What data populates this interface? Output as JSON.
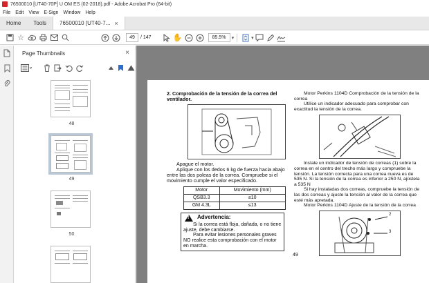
{
  "window": {
    "title": "76500010 [UT40-70P] U OM ES (02-2018).pdf - Adobe Acrobat Pro (64-bit)"
  },
  "menu": [
    "File",
    "Edit",
    "View",
    "E-Sign",
    "Window",
    "Help"
  ],
  "tabs": {
    "home": "Home",
    "tools": "Tools",
    "document": "76500010 [UT40-7...",
    "close": "×"
  },
  "toolbar": {
    "page_current": "49",
    "page_total": "/ 147",
    "zoom": "85.5%"
  },
  "panel": {
    "title": "Page Thumbnails",
    "close": "×",
    "thumbnails": [
      {
        "label": "48"
      },
      {
        "label": "49",
        "selected": true
      },
      {
        "label": "50"
      },
      {
        "label": ""
      }
    ]
  },
  "doc": {
    "left": {
      "heading": "2. Comprobación de la tensión de la correa del ventilador.",
      "p1": "Apague el motor.",
      "p2": "Aplique con los dedos 6 kg de fuerza hacia abajo entre las dos poleas de la correa. Compruebe si el movimiento cumple el valor especificado.",
      "table_headers": [
        "Motor",
        "Movimiento (mm)"
      ],
      "table_rows": [
        [
          "QSB3.3",
          "≤10"
        ],
        [
          "GM 4.3L",
          "≤13"
        ]
      ],
      "warning_title": "Advertencia:",
      "warning_p1": "Si la correa está floja, dañada, o no tiene ajuste, debe cambiarse.",
      "warning_p2": "Para evitar lesiones personales graves NO realice esta comprobación con el motor en marcha."
    },
    "right": {
      "heading": "Motor Perkins 1104D Comprobación de la tensión de la correa",
      "p1": "Utilice un indicador adecuado para comprobar con exactitud la tensión de la correa.",
      "p2": "Instale un indicador de tensión de correas (1) sobre la correa en el centro del trecho más largo y compruebe la tensión. La tensión correcta para una correa nueva es de 535 N. Si la tensión de la correa es inferior a 250 N, ajústela a 535 N",
      "p3": "Si hay instaladas dos correas, compruebe la tensión de las dos correas y ajuste la tensión al valor de la correa que esté más apretada.",
      "p4": "Motor Perkins 1104D Ajuste de la tensión de la correa",
      "callout_2": "2",
      "callout_3": "3"
    },
    "page_number": "49"
  }
}
